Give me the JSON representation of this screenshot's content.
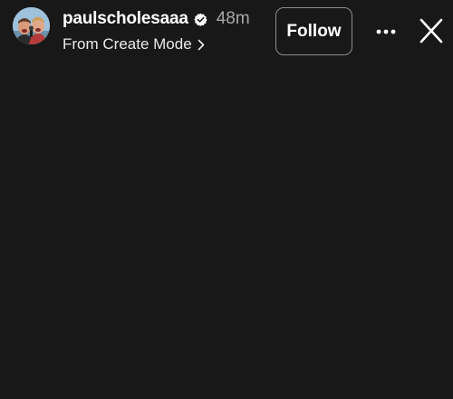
{
  "story": {
    "user": {
      "username": "paulscholesaaa",
      "verified": true,
      "avatar_icon": "user-avatar"
    },
    "timestamp": "48m",
    "subtitle": "From Create Mode",
    "follow_label": "Follow",
    "more_icon": "more-options-icon",
    "close_icon": "close-icon"
  },
  "colors": {
    "background": "#181818",
    "text": "#ffffff",
    "muted_text": "#a9a9a9",
    "button_border": "#8c8c8c"
  }
}
